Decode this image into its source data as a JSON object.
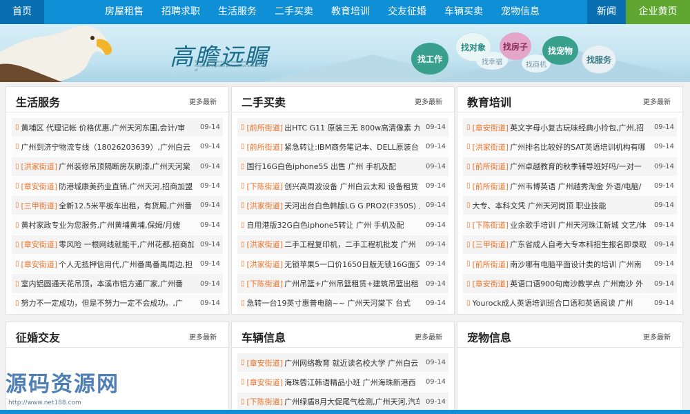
{
  "nav": {
    "home": "首页",
    "items": [
      "房屋租售",
      "招聘求职",
      "生活服务",
      "二手买卖",
      "教育培训",
      "交友征婚",
      "车辆买卖",
      "宠物信息"
    ],
    "news": "新闻",
    "biz": "企业黄页"
  },
  "banner": {
    "brand": "高瞻远瞩",
    "brand_sub": "Stand tall to broadly look down from a height to a global perspective and review of",
    "bubbles": [
      "找工作",
      "找对象",
      "找幸福",
      "找房子",
      "找商机",
      "找宠物",
      "找服务"
    ]
  },
  "more_label": "更多最新",
  "panels": [
    {
      "title": "生活服务",
      "rows": [
        {
          "tag": "",
          "text": "黄埔区 代理记帐 价格优惠,广州天河东圃,会计/审",
          "date": "09-14"
        },
        {
          "tag": "",
          "text": "广州到济宁物流专线（18026203639）,广州白云",
          "date": "09-14"
        },
        {
          "tag": "[洪家街道]",
          "text": "广州装修吊顶隔断房灰刷漆,广州天河棠",
          "date": "09-14"
        },
        {
          "tag": "[章安街道]",
          "text": "防港城康美药业直销,广州天河,招商加盟",
          "date": "09-14"
        },
        {
          "tag": "[三甲街道]",
          "text": "全新12.5米平板车出租，有货厢,广州番",
          "date": "09-14"
        },
        {
          "tag": "",
          "text": "黄村家政专业为您服务,广州黄埔黄埔,保姆/月嫂",
          "date": "09-14"
        },
        {
          "tag": "[章安街道]",
          "text": "零风险 一根网线就能干,广州花都,招商加",
          "date": "09-14"
        },
        {
          "tag": "[章安街道]",
          "text": "个人无抵押信用代,广州番禺番禺周边,担",
          "date": "09-14"
        },
        {
          "tag": "",
          "text": "室内铝圆通天花吊顶，本溪市铝方通厂家,广州番",
          "date": "09-14"
        },
        {
          "tag": "",
          "text": "努力不一定成功，但是不努力一定不会成功。,广",
          "date": "09-14"
        }
      ]
    },
    {
      "title": "二手买卖",
      "rows": [
        {
          "tag": "[前所街道]",
          "text": "出HTC G11 原装三无 800w高清像素 九",
          "date": "09-14"
        },
        {
          "tag": "[前所街道]",
          "text": "紧急转让:IBM商务笔记本、DELL原装台",
          "date": "09-14"
        },
        {
          "tag": "",
          "text": "国行16G白色iphone5S 出售 广州 手机及配",
          "date": "09-14"
        },
        {
          "tag": "[下陈街道]",
          "text": "创兴高周波设备 广州白云太和 设备租赁",
          "date": "09-14"
        },
        {
          "tag": "[洪家街道]",
          "text": "天河出台白色韩版LG G PRO2(F350S) 广",
          "date": "09-14"
        },
        {
          "tag": "",
          "text": "自用港版32G白色iphone5转让 广州 手机及配",
          "date": "09-14"
        },
        {
          "tag": "[洪家街道]",
          "text": "二手工程复印机，二手工程机批发 广州",
          "date": "09-14"
        },
        {
          "tag": "[洪家街道]",
          "text": "无锁苹果5一口价1650日版无锁16G面交",
          "date": "09-14"
        },
        {
          "tag": "[下陈街道]",
          "text": "广州吊篮+广州吊篮租赁+建筑吊篮出租",
          "date": "09-14"
        },
        {
          "tag": "",
          "text": "急转一台19英寸惠普电脑~~ 广州天河棠下 台式",
          "date": "09-14"
        }
      ]
    },
    {
      "title": "教育培训",
      "rows": [
        {
          "tag": "[章安街道]",
          "text": "英文字母小复古玩味经典小拎包,广州,招",
          "date": "09-14"
        },
        {
          "tag": "[洪家街道]",
          "text": "广州排名比较好的SAT英语培训机构有哪",
          "date": "09-14"
        },
        {
          "tag": "[前所街道]",
          "text": "广州卓越教育的秋季辅导班好吗/一对一",
          "date": "09-14"
        },
        {
          "tag": "[前所街道]",
          "text": "广州韦博英语 广州越秀淘金 外语/电脑/",
          "date": "09-14"
        },
        {
          "tag": "",
          "text": "大专、本科文凭 广州天河岗顶 职业技能",
          "date": "09-14"
        },
        {
          "tag": "[下陈街道]",
          "text": "业余歌手培训 广州天河珠江新城 文艺/体",
          "date": "09-14"
        },
        {
          "tag": "[三甲街道]",
          "text": "广东省成人自考大专本科招生报名即录取",
          "date": "09-14"
        },
        {
          "tag": "[前所街道]",
          "text": "南沙哪有电脑平面设计类的培训 广州南",
          "date": "09-14"
        },
        {
          "tag": "[章安街道]",
          "text": "英语口语900句南沙教学点 广州南沙 外",
          "date": "09-14"
        },
        {
          "tag": "",
          "text": "Yourock成人英语培训班合口语和英语阅读 广州",
          "date": "09-14"
        }
      ]
    },
    {
      "title": "征婚交友",
      "rows": []
    },
    {
      "title": "车辆信息",
      "rows": [
        {
          "tag": "[章安街道]",
          "text": "广州网络教育 就近读名校大学 广州白云",
          "date": "09-14"
        },
        {
          "tag": "[章安街道]",
          "text": "海珠蓉江韩语精品小班 广州海珠新港西",
          "date": "09-14"
        },
        {
          "tag": "[下陈街道]",
          "text": "广州绿盾8月大促尾气检测,广州天河,汽车",
          "date": "09-14"
        }
      ]
    },
    {
      "title": "宠物信息",
      "rows": []
    }
  ],
  "watermark": {
    "text": "源码资源网",
    "url": "http://www.net188.com"
  }
}
